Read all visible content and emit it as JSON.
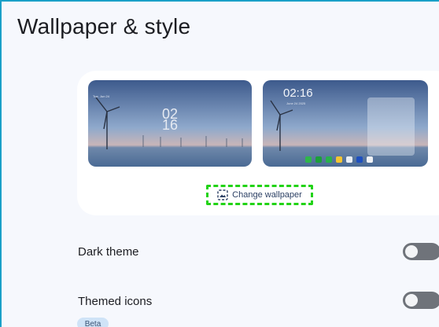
{
  "header": {
    "title": "Wallpaper & style"
  },
  "previews": {
    "lock": {
      "date": "Tue, Jun 24",
      "clock_hour": "02",
      "clock_minute": "16"
    },
    "home": {
      "clock": "02:16",
      "date": "June 24 2025"
    }
  },
  "change_wallpaper": {
    "label": "Change wallpaper"
  },
  "settings": {
    "dark_theme": {
      "label": "Dark theme",
      "enabled": false
    },
    "themed_icons": {
      "label": "Themed icons",
      "badge": "Beta",
      "enabled": false
    }
  },
  "colors": {
    "accent": "#1aa0c8",
    "focus_outline": "#22d316",
    "toggle_off": "#6f737a"
  },
  "icons": {
    "change_wallpaper": "wallpaper-icon"
  }
}
